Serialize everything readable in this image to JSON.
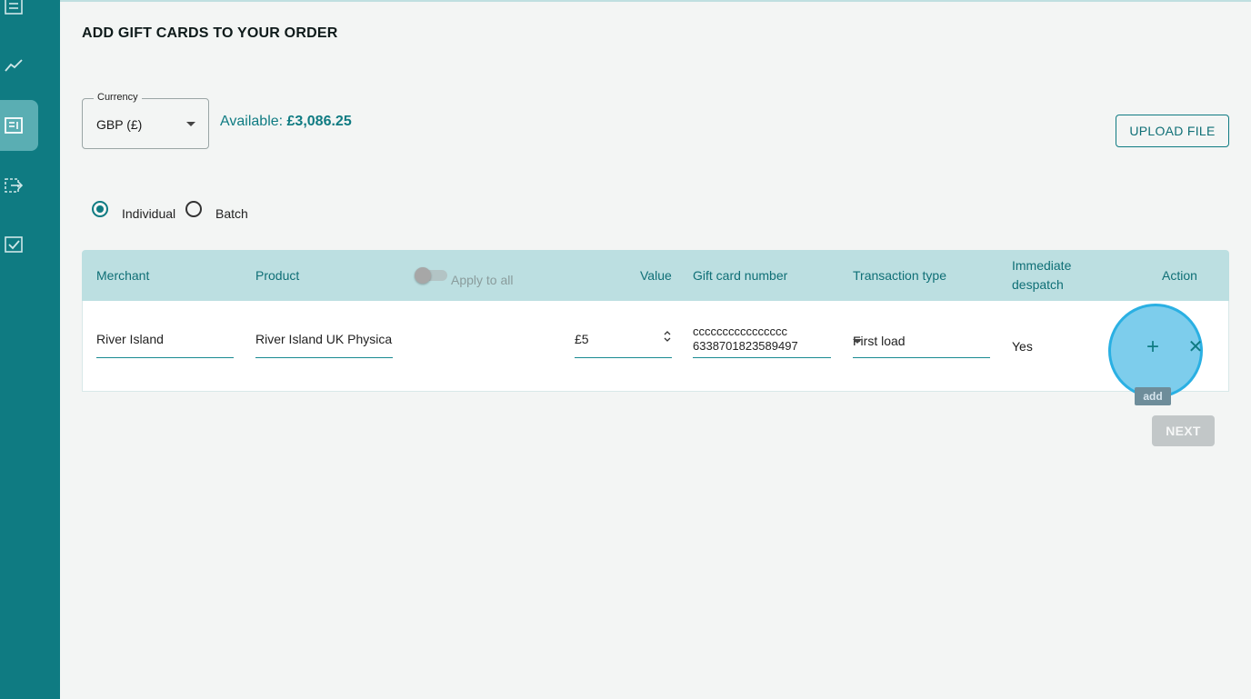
{
  "page": {
    "title": "ADD GIFT CARDS TO YOUR ORDER",
    "available_label": "Available: ",
    "available_amount": "£3,086.25"
  },
  "currency": {
    "legend": "Currency",
    "value": "GBP (£)"
  },
  "buttons": {
    "upload": "UPLOAD FILE",
    "next": "NEXT",
    "add_tooltip": "add"
  },
  "mode": {
    "individual": "Individual",
    "batch": "Batch",
    "selected": "Individual"
  },
  "table": {
    "headers": {
      "merchant": "Merchant",
      "product": "Product",
      "apply_all": "Apply to all",
      "value": "Value",
      "gift_card_number": "Gift card number",
      "transaction_type": "Transaction type",
      "immediate_despatch_1": "Immediate",
      "immediate_despatch_2": "despatch",
      "action": "Action"
    },
    "row": {
      "merchant": "River Island",
      "product": "River Island UK Physica",
      "value": "£5",
      "gift_card_line1": "cccccccccccccccc",
      "gift_card_line2": "6338701823589497",
      "transaction_type": "First load",
      "immediate_despatch": "Yes"
    }
  },
  "colors": {
    "brand": "#0f7b82",
    "table_header": "#bcdfe1",
    "highlight": "#7dcdec"
  },
  "icons": {
    "sidebar": [
      "list-icon",
      "chart-line-icon",
      "document-icon",
      "transfer-icon",
      "checkbox-icon"
    ]
  }
}
